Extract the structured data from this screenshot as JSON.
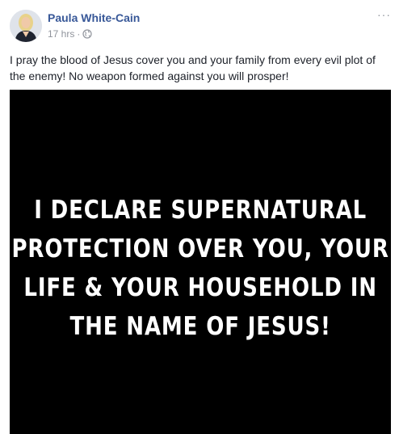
{
  "post": {
    "author_name": "Paula White-Cain",
    "timestamp": "17 hrs",
    "separator": "·",
    "privacy_icon": "globe-icon",
    "more_label": "···",
    "text": "I pray the blood of Jesus cover you and your family from every evil plot of the enemy! No weapon formed against you will prosper!",
    "image_lines": [
      "I DECLARE SUPERNATURAL",
      "PROTECTION OVER YOU, YOUR",
      "LIFE & YOUR HOUSEHOLD IN",
      "THE NAME OF JESUS!"
    ]
  },
  "colors": {
    "author_link": "#385898",
    "meta_gray": "#90949c",
    "body_text": "#1d2129",
    "image_background": "#000000",
    "image_text": "#ffffff"
  }
}
